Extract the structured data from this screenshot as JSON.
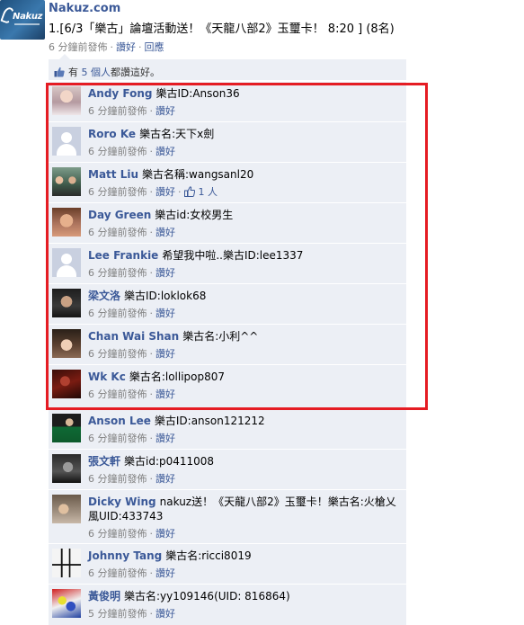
{
  "post": {
    "page_name": "Nakuz.com",
    "logo_text": "Nakuz",
    "text": "1.[6/3「樂古」論壇活動送！《天龍八部2》玉璽卡！ 8:20 ] (8名)",
    "time": "6 分鐘前發佈",
    "like_label": "讚好",
    "comment_label": "回應"
  },
  "likes": {
    "prefix": "有",
    "count_text": "5 個人",
    "suffix": "都讚這好。"
  },
  "comments": [
    {
      "author": "Andy Fong",
      "text": "樂古ID:Anson36",
      "time": "6 分鐘前發佈",
      "like_label": "讚好",
      "avatar": "photo-girl"
    },
    {
      "author": "Roro Ke",
      "text": "樂古名:天下x劍",
      "time": "6 分鐘前發佈",
      "like_label": "讚好",
      "avatar": "default-silhouette"
    },
    {
      "author": "Matt Liu",
      "text": "樂古名稱:wangsanl20",
      "time": "6 分鐘前發佈",
      "like_label": "讚好",
      "likes_count": "1 人",
      "avatar": "photo-group"
    },
    {
      "author": "Day Green",
      "text": "樂古id:女校男生",
      "time": "6 分鐘前發佈",
      "like_label": "讚好",
      "avatar": "photo-face"
    },
    {
      "author": "Lee Frankie",
      "text": "希望我中啦..樂古ID:lee1337",
      "time": "6 分鐘前發佈",
      "like_label": "讚好",
      "avatar": "default-silhouette"
    },
    {
      "author": "梁文洛",
      "text": "樂古ID:loklok68",
      "time": "6 分鐘前發佈",
      "like_label": "讚好",
      "avatar": "photo-dark"
    },
    {
      "author": "Chan Wai Shan",
      "text": "樂古名:小利^^",
      "time": "6 分鐘前發佈",
      "like_label": "讚好",
      "avatar": "photo-girl-2"
    },
    {
      "author": "Wk Kc",
      "text": "樂古名:lollipop807",
      "time": "6 分鐘前發佈",
      "like_label": "讚好",
      "avatar": "photo-red"
    },
    {
      "author": "Anson Lee",
      "text": "樂古ID:anson121212",
      "time": "6 分鐘前發佈",
      "like_label": "讚好",
      "avatar": "photo-snooker"
    },
    {
      "author": "張文軒",
      "text": "樂古id:p0411008",
      "time": "6 分鐘前發佈",
      "like_label": "讚好",
      "avatar": "photo-bw"
    },
    {
      "author": "Dicky Wing",
      "text": "nakuz送！《天龍八部2》玉璽卡！樂古名:火槍乂風UID:433743",
      "time": "6 分鐘前發佈",
      "like_label": "讚好",
      "avatar": "photo-cartoon"
    },
    {
      "author": "Johnny Tang",
      "text": "樂古名:ricci8019",
      "time": "6 分鐘前發佈",
      "like_label": "讚好",
      "avatar": "photo-calligraphy"
    },
    {
      "author": "黃俊明",
      "text": "樂古名:yy109146(UID: 816864)",
      "time": "5 分鐘前發佈",
      "like_label": "讚好",
      "avatar": "photo-robot"
    }
  ],
  "colors": {
    "link": "#3b5998",
    "feed_bg": "#eceff5",
    "highlight": "#e51c23",
    "meta": "#808080"
  }
}
